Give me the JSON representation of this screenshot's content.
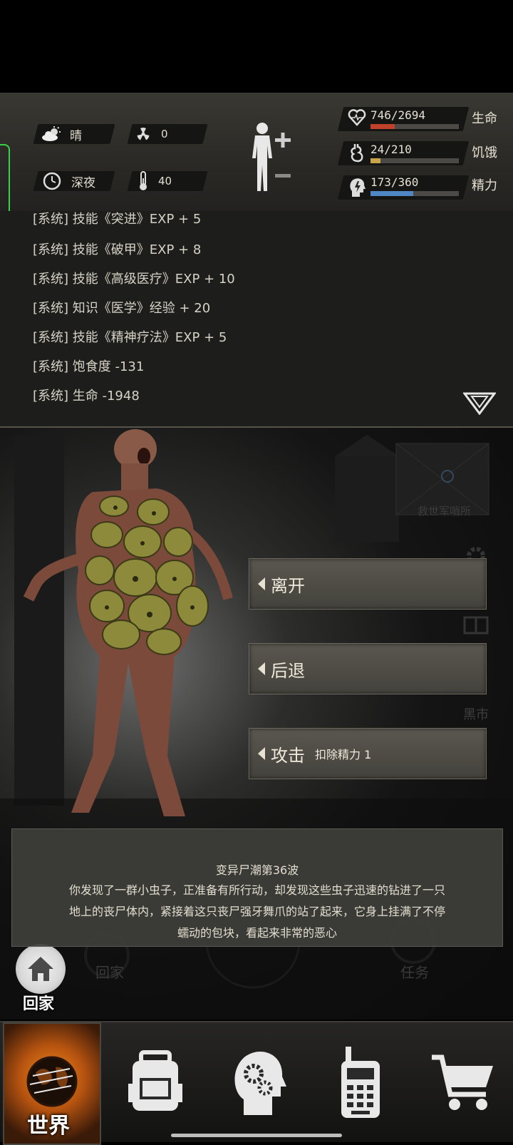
{
  "status": {
    "weather": "晴",
    "radiation": "0",
    "time_of_day": "深夜",
    "temperature": "40",
    "health": {
      "label": "生命",
      "value": "746/2694",
      "fraction": 0.277,
      "color": "#c0412c"
    },
    "hunger": {
      "label": "饥饿",
      "value": "24/210",
      "fraction": 0.114,
      "color": "#c9a44a"
    },
    "energy": {
      "label": "精力",
      "value": "173/360",
      "fraction": 0.48,
      "color": "#4f86c4"
    }
  },
  "log": {
    "lines": [
      "[系统] 技能《突进》EXP + 5",
      "[系统] 技能《破甲》EXP + 8",
      "[系统] 技能《高级医疗》EXP + 10",
      "[系统] 知识《医学》经验 + 20",
      "[系统] 技能《精神疗法》EXP + 5",
      "[系统] 饱食度 -131",
      "[系统] 生命 -1948"
    ]
  },
  "scene": {
    "location_sign": "救世军哨所",
    "black_market": "黑市",
    "home_label": "回家",
    "home_label_faded": "回家",
    "task_label_faded": "任务"
  },
  "actions": [
    {
      "label": "离开",
      "sub": ""
    },
    {
      "label": "后退",
      "sub": ""
    },
    {
      "label": "攻击",
      "sub": "扣除精力 1"
    }
  ],
  "event": {
    "title": "变异尸潮第36波",
    "lines": [
      "你发现了一群小虫子，正准备有所行动，却发现这些虫子迅速的钻进了一只",
      "地上的丧尸体内，紧接着这只丧尸强牙舞爪的站了起来，它身上挂满了不停",
      "蠕动的包块，看起来非常的恶心"
    ]
  },
  "nav": {
    "world_label": "世界",
    "items": [
      "globe-icon",
      "backpack-icon",
      "head-gears-icon",
      "walkie-talkie-icon",
      "cart-icon"
    ]
  }
}
